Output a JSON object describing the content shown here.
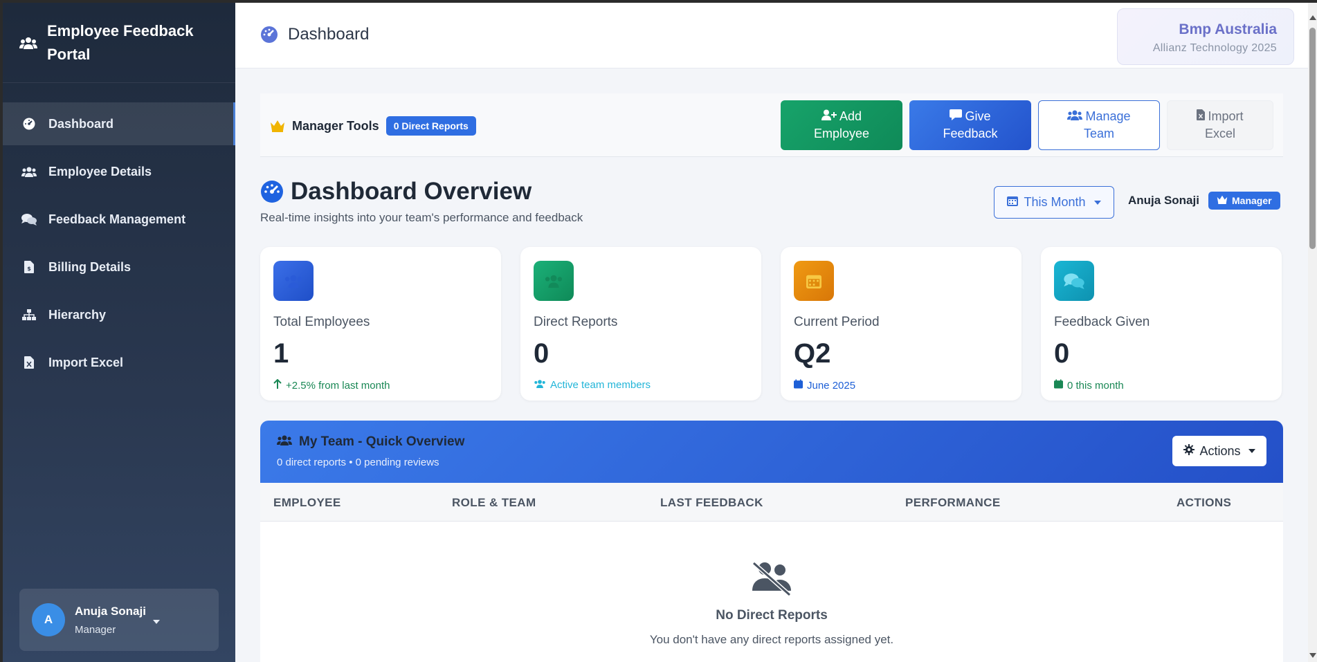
{
  "brand": {
    "title": "Employee Feedback Portal"
  },
  "sidebar": {
    "items": [
      {
        "label": "Dashboard",
        "icon": "gauge-icon",
        "active": true
      },
      {
        "label": "Employee Details",
        "icon": "users-icon"
      },
      {
        "label": "Feedback Management",
        "icon": "comments-icon"
      },
      {
        "label": "Billing Details",
        "icon": "invoice-icon"
      },
      {
        "label": "Hierarchy",
        "icon": "sitemap-icon"
      },
      {
        "label": "Import Excel",
        "icon": "excel-file-icon"
      }
    ],
    "user": {
      "initial": "A",
      "name": "Anuja Sonaji",
      "role": "Manager"
    }
  },
  "header": {
    "title": "Dashboard",
    "org": {
      "name": "Bmp Australia",
      "subtitle": "Allianz Technology 2025"
    }
  },
  "tools": {
    "label": "Manager Tools",
    "badge": "0 Direct Reports",
    "buttons": {
      "add_employee": [
        "Add",
        "Employee"
      ],
      "give_feedback": [
        "Give",
        "Feedback"
      ],
      "manage_team": [
        "Manage",
        "Team"
      ],
      "import_excel": [
        "Import",
        "Excel"
      ]
    }
  },
  "overview": {
    "title": "Dashboard Overview",
    "subtitle": "Real-time insights into your team's performance and feedback",
    "period": "This Month",
    "user": "Anuja Sonaji",
    "role_badge": "Manager"
  },
  "cards": [
    {
      "label": "Total Employees",
      "value": "1",
      "foot": "+2.5% from last month",
      "color": "#2563eb",
      "foot_color": "#198754"
    },
    {
      "label": "Direct Reports",
      "value": "0",
      "foot": "Active team members",
      "color": "#16a06a",
      "foot_color": "#22b5d8"
    },
    {
      "label": "Current Period",
      "value": "Q2",
      "foot": "June 2025",
      "color": "#e88a0c",
      "foot_color": "#1d5fd6"
    },
    {
      "label": "Feedback Given",
      "value": "0",
      "foot": "0 this month",
      "color": "#14a8c8",
      "foot_color": "#198754"
    }
  ],
  "team": {
    "title": "My Team - Quick Overview",
    "subtitle": "0 direct reports • 0 pending reviews",
    "actions": "Actions",
    "columns": [
      "EMPLOYEE",
      "ROLE & TEAM",
      "LAST FEEDBACK",
      "PERFORMANCE",
      "ACTIONS"
    ],
    "empty_title": "No Direct Reports",
    "empty_sub": "You don't have any direct reports assigned yet."
  }
}
